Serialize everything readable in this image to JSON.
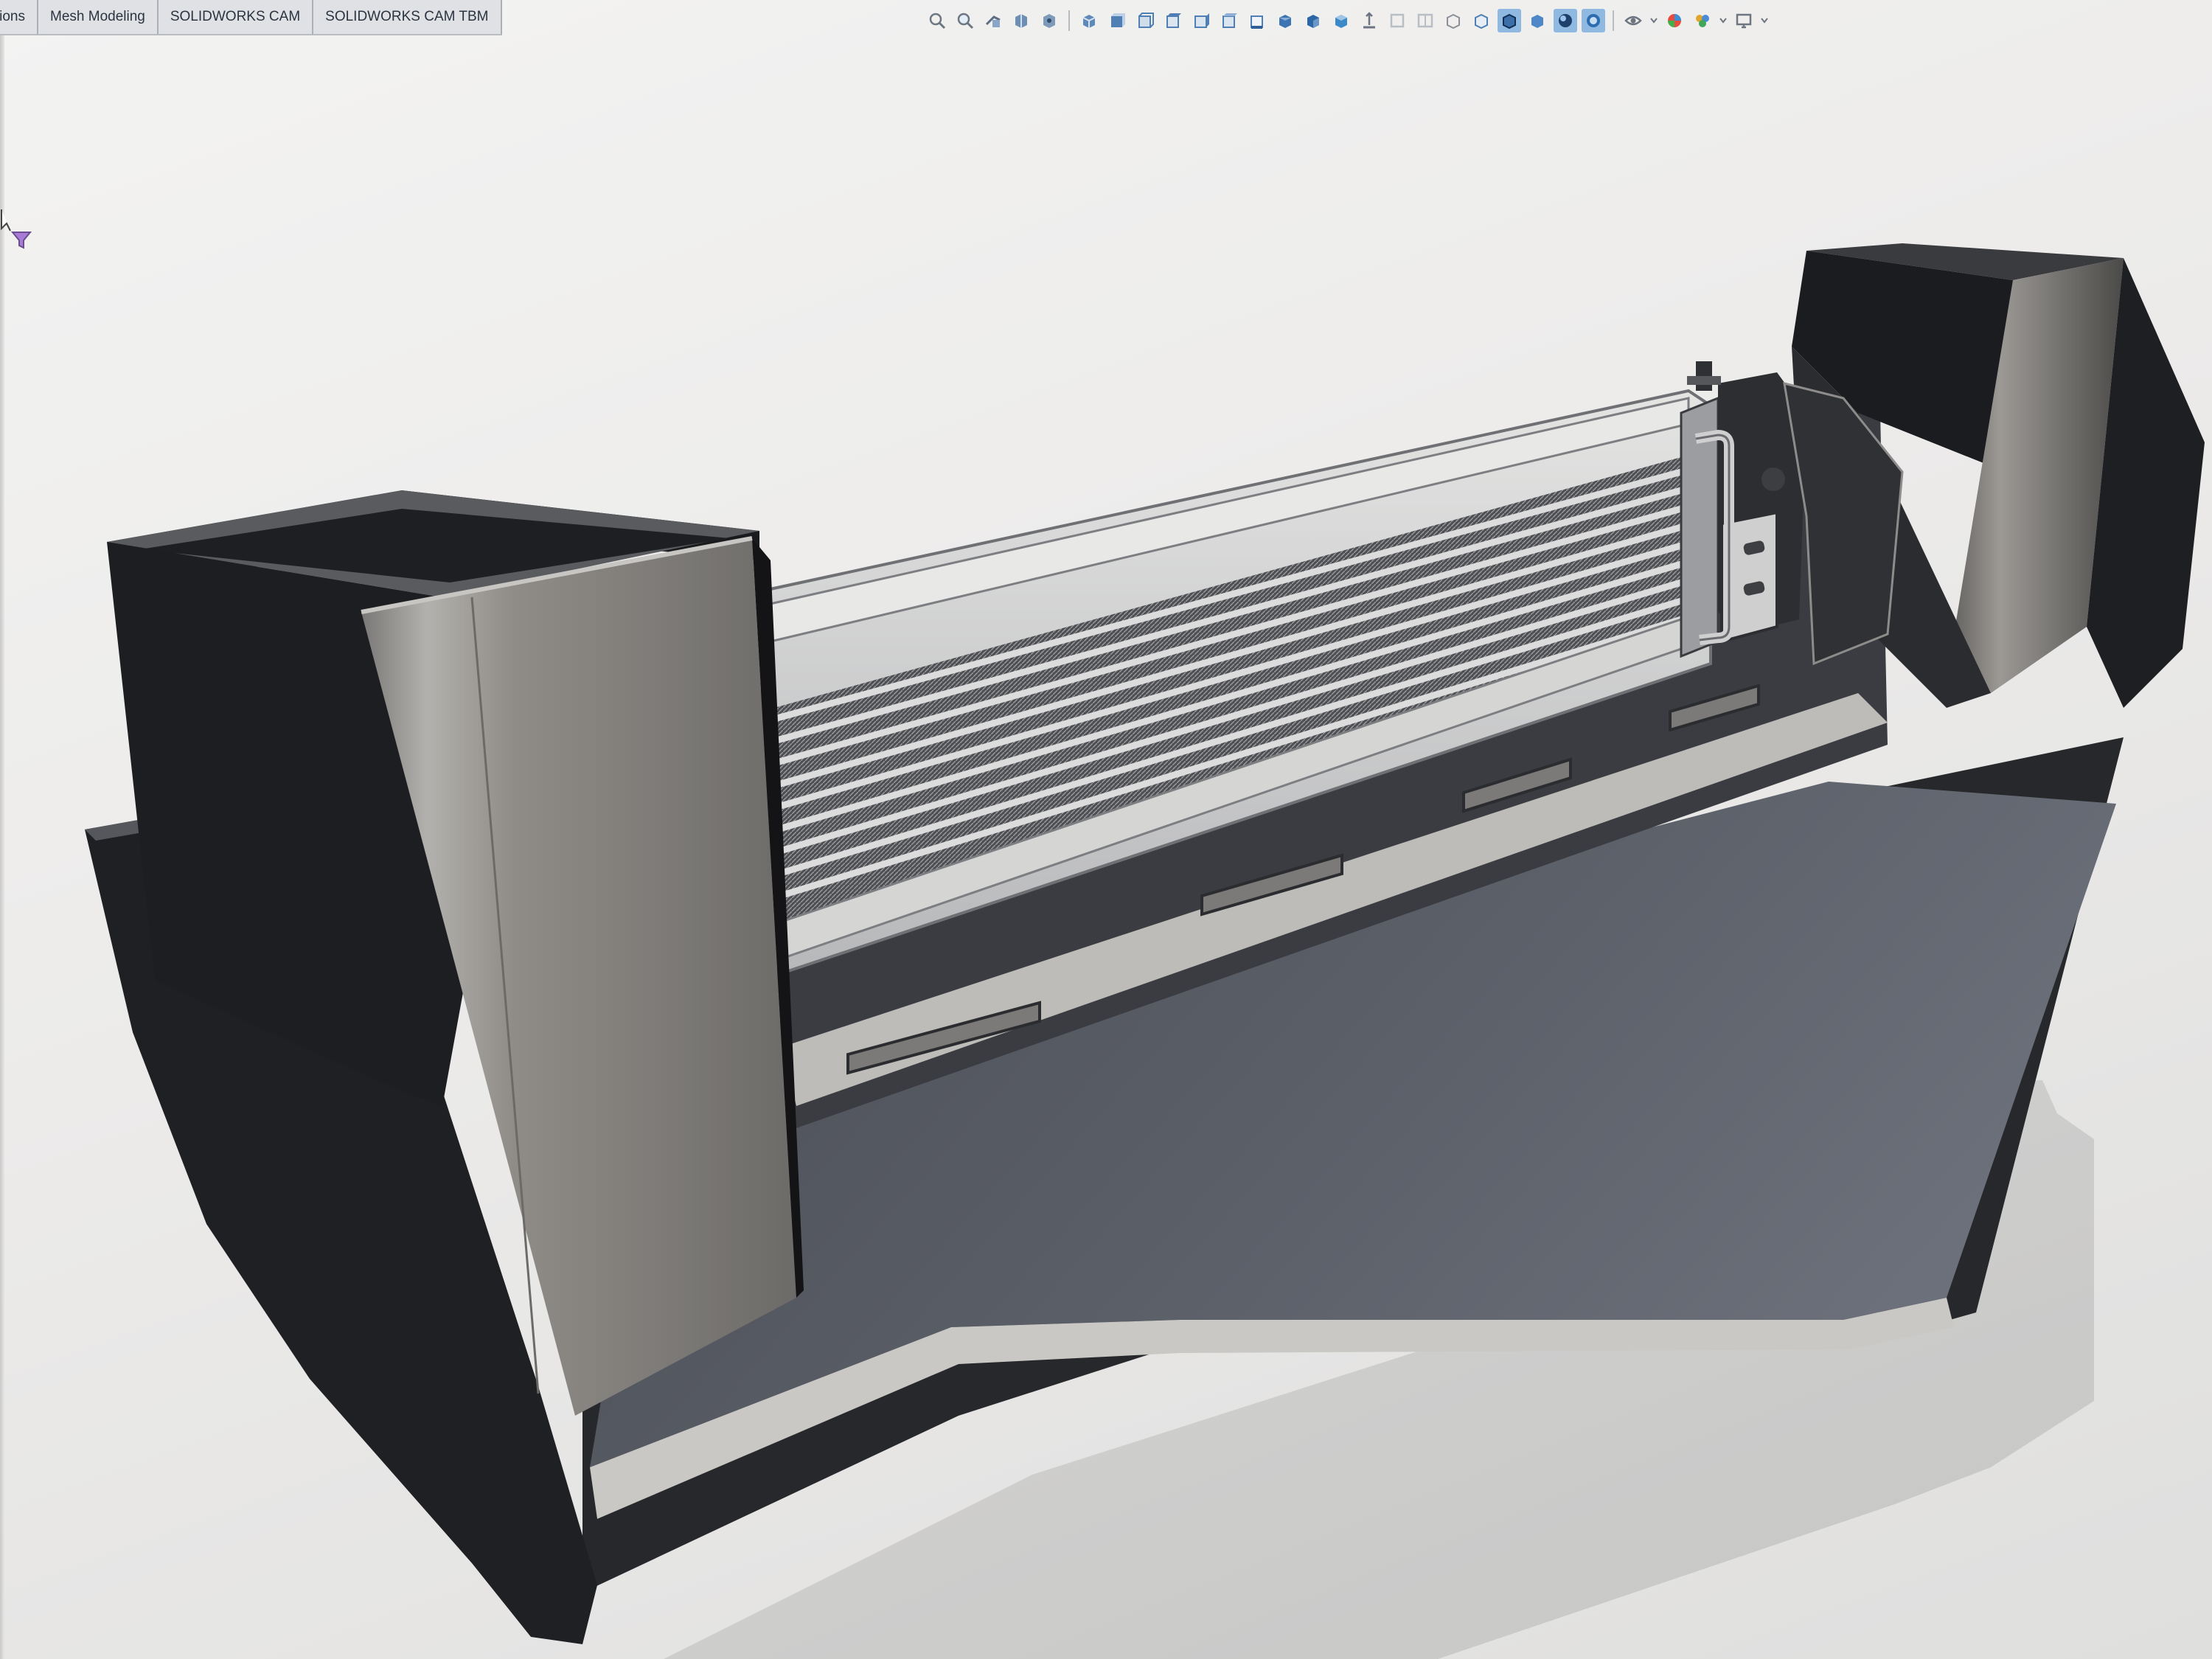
{
  "tabs": [
    {
      "label": "sions"
    },
    {
      "label": "Mesh Modeling"
    },
    {
      "label": "SOLIDWORKS CAM"
    },
    {
      "label": "SOLIDWORKS CAM TBM"
    }
  ],
  "view_toolbar": {
    "icons": [
      "zoom-to-fit-icon",
      "zoom-to-area-icon",
      "previous-view-icon",
      "section-view-icon",
      "dynamic-annotation-icon",
      "view-orientation-icon",
      "view-front-icon",
      "view-back-icon",
      "view-left-icon",
      "view-right-icon",
      "view-top-icon",
      "view-bottom-icon",
      "view-isometric-icon",
      "view-trimetric-icon",
      "view-dimetric-icon",
      "normal-to-icon",
      "single-view-icon",
      "two-view-icon",
      "wireframe-icon",
      "hidden-lines-icon",
      "shaded-with-edges-icon",
      "shaded-icon",
      "realview-icon",
      "ambient-occlusion-icon",
      "hide-show-items-icon",
      "edit-appearance-icon",
      "apply-scene-icon",
      "view-settings-icon"
    ],
    "active_index": 20
  },
  "colors": {
    "background": "#ecebea",
    "toolbar_active": "#8fb9e0",
    "tab_strip": "#d6d8db",
    "model_dark": "#26282b",
    "model_face": "#45474d",
    "radiator_silver": "#c9cacc"
  }
}
